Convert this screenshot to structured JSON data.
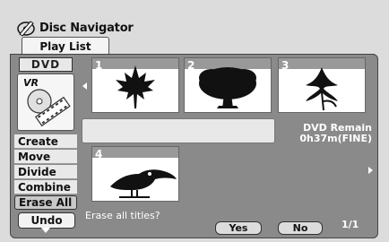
{
  "app": {
    "title": "Disc Navigator",
    "icon": "disc-navigator-icon"
  },
  "tab": {
    "label": "Play List"
  },
  "sidebar": {
    "disc_type": "DVD",
    "format_label": "VR",
    "menu": [
      {
        "label": "Create",
        "selected": false
      },
      {
        "label": "Move",
        "selected": false
      },
      {
        "label": "Divide",
        "selected": false
      },
      {
        "label": "Combine",
        "selected": false
      },
      {
        "label": "Erase All",
        "selected": true
      }
    ],
    "undo_label": "Undo"
  },
  "thumbnails": [
    {
      "number": "1",
      "image": "maple-leaf"
    },
    {
      "number": "2",
      "image": "tree"
    },
    {
      "number": "3",
      "image": "lily-flower"
    },
    {
      "number": "4",
      "image": "toucan"
    }
  ],
  "remain": {
    "line1": "DVD Remain",
    "line2": "0h37m(FINE)"
  },
  "dialog": {
    "question": "Erase all titles?",
    "yes": "Yes",
    "no": "No"
  },
  "page_indicator": "1/1",
  "colors": {
    "panel": "#8a8a8a",
    "background": "#dcdcdc",
    "text_on_panel": "#ffffff"
  }
}
